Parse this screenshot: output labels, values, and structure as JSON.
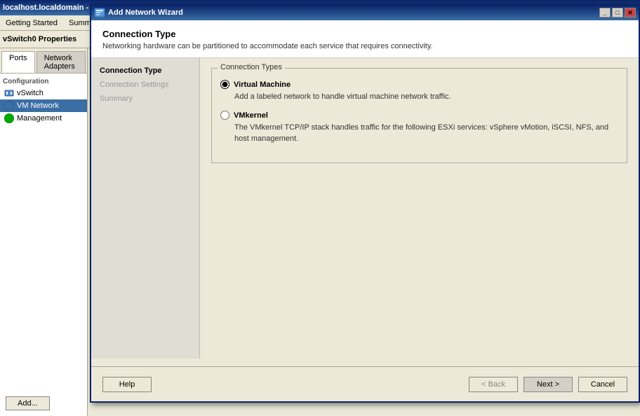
{
  "bgApp": {
    "titlebar": "localhost.localdomain - vSphere Client",
    "tabs": [
      "Ports",
      "Network Adapters"
    ],
    "windowTitle": "vSwitch0 Properties"
  },
  "menuItems": [
    "Getting Started",
    "Summary"
  ],
  "sidebar": {
    "sectionLabel": "Configuration",
    "items": [
      {
        "label": "vSwitch",
        "type": "switch"
      },
      {
        "label": "VM Network",
        "type": "vm",
        "active": true
      },
      {
        "label": "Management",
        "type": "mgmt"
      }
    ],
    "addButton": "Add..."
  },
  "dialog": {
    "title": "Add Network Wizard",
    "header": {
      "title": "Connection Type",
      "description": "Networking hardware can be partitioned to accommodate each service that requires connectivity."
    },
    "wizardNav": [
      {
        "label": "Connection Type",
        "state": "active"
      },
      {
        "label": "Connection Settings",
        "state": "inactive"
      },
      {
        "label": "Summary",
        "state": "inactive"
      }
    ],
    "content": {
      "groupTitle": "Connection Types",
      "options": [
        {
          "id": "virtual-machine",
          "label": "Virtual Machine",
          "description": "Add a labeled network to handle virtual machine network traffic.",
          "selected": true
        },
        {
          "id": "vmkernel",
          "label": "VMkernel",
          "description": "The VMkernel TCP/IP stack handles traffic for the following ESXi services: vSphere vMotion, iSCSI, NFS, and host management.",
          "selected": false
        }
      ]
    },
    "footer": {
      "helpBtn": "Help",
      "backBtn": "< Back",
      "nextBtn": "Next >",
      "cancelBtn": "Cancel"
    }
  }
}
